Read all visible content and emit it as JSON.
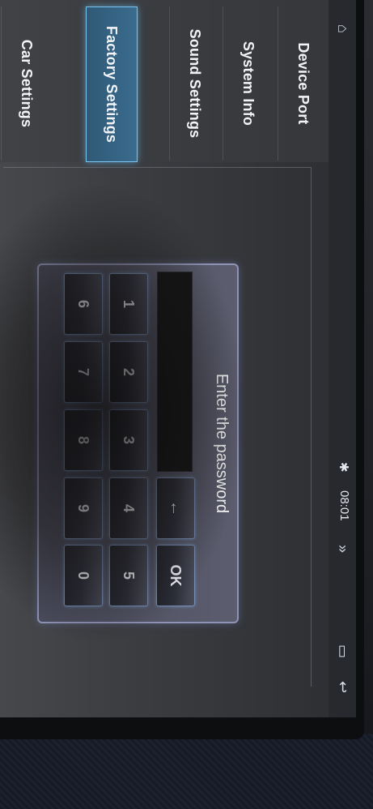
{
  "nav": {
    "home_icon": "home-icon",
    "back_icon": "back-icon",
    "window_icon": "window-icon",
    "chevrons_icon": "double-chevron-icon",
    "bluetooth_icon": "bluetooth-icon"
  },
  "status_bar": {
    "time": "08:01"
  },
  "sidebar": {
    "items": [
      {
        "label": "Device Port"
      },
      {
        "label": "System Info"
      },
      {
        "label": "Factory Settings",
        "active": true
      },
      {
        "label": "Sound Settings"
      },
      {
        "label": "Car Settings"
      }
    ]
  },
  "dialog": {
    "title": "Enter the password",
    "password_value": "",
    "backspace_label": "←",
    "ok_label": "OK",
    "keys": [
      "1",
      "2",
      "3",
      "4",
      "5",
      "6",
      "7",
      "8",
      "9",
      "0"
    ]
  },
  "colors": {
    "accent": "#3a6c8e",
    "dialog_border": "#8f93b6",
    "key_glow": "#7b8fb6"
  }
}
